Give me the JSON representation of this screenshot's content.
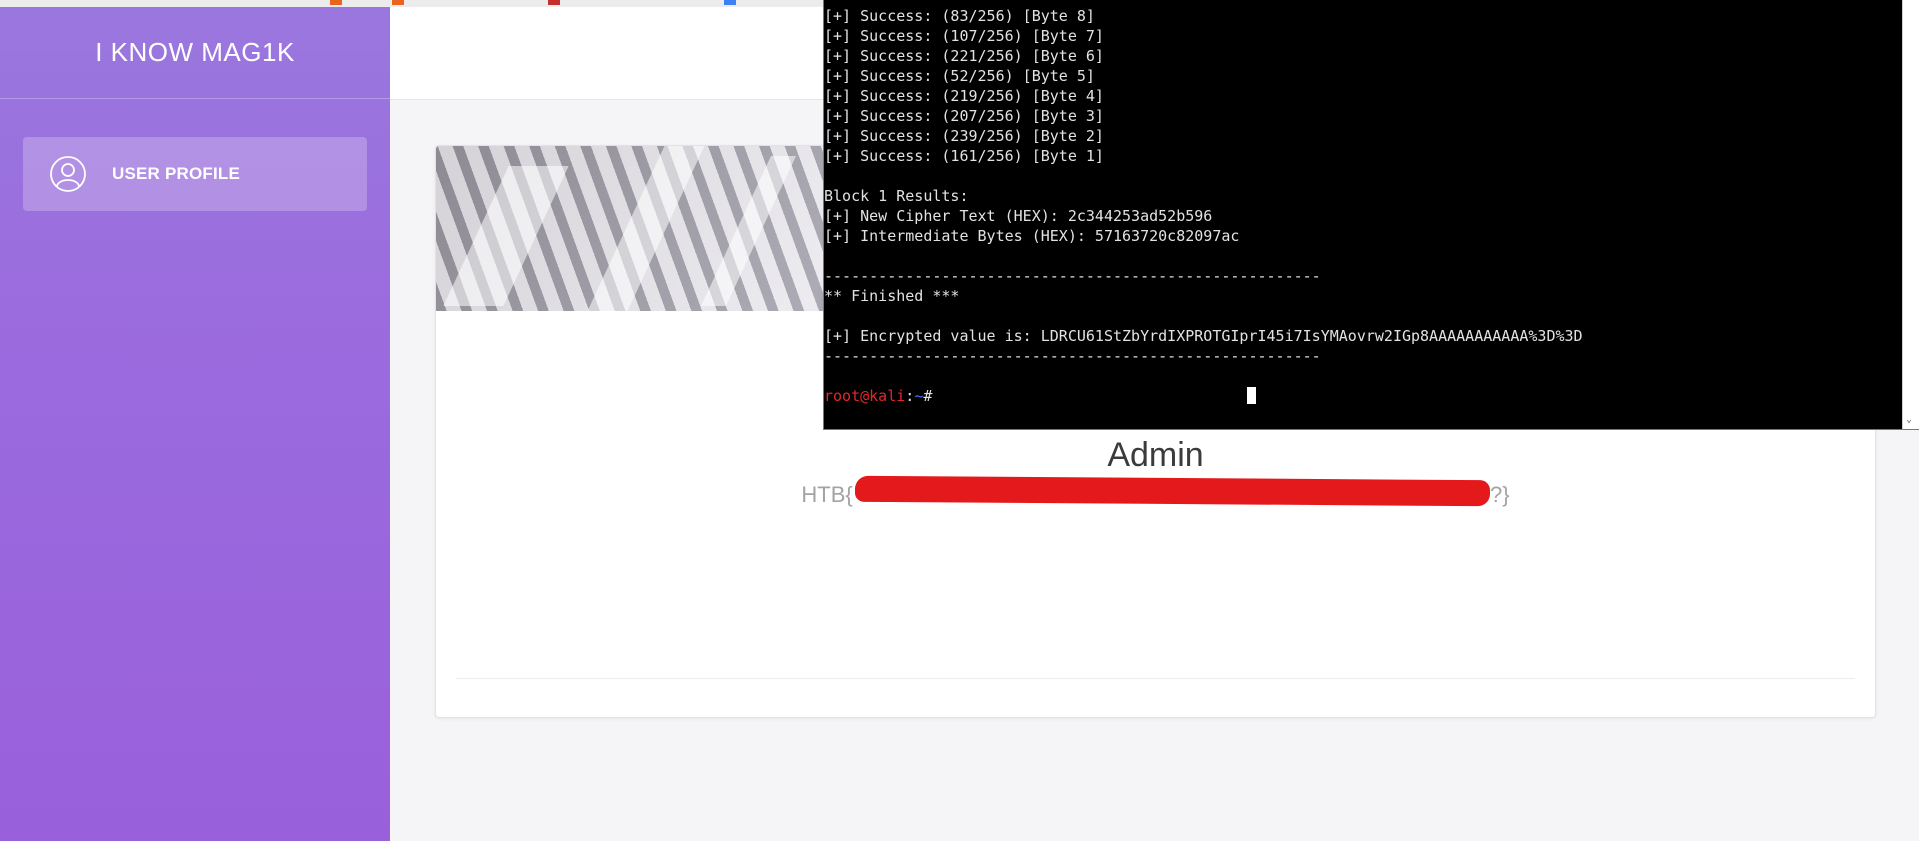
{
  "app": {
    "brand": "I KNOW MAG1K"
  },
  "sidebar": {
    "items": [
      {
        "label": "USER PROFILE",
        "icon": "user-icon"
      }
    ]
  },
  "profile": {
    "name": "Admin",
    "flag_visible": "HTB{",
    "flag_tail": "??}"
  },
  "terminal": {
    "lines": [
      "[+] Success: (83/256) [Byte 8]",
      "[+] Success: (107/256) [Byte 7]",
      "[+] Success: (221/256) [Byte 6]",
      "[+] Success: (52/256) [Byte 5]",
      "[+] Success: (219/256) [Byte 4]",
      "[+] Success: (207/256) [Byte 3]",
      "[+] Success: (239/256) [Byte 2]",
      "[+] Success: (161/256) [Byte 1]",
      "",
      "Block 1 Results:",
      "[+] New Cipher Text (HEX): 2c344253ad52b596",
      "[+] Intermediate Bytes (HEX): 57163720c82097ac",
      "",
      "-------------------------------------------------------",
      "** Finished ***",
      "",
      "[+] Encrypted value is: LDRCU61StZbYrdIXPROTGIprI45i7IsYMAovrw2IGp8AAAAAAAAAAA%3D%3D",
      "-------------------------------------------------------",
      ""
    ],
    "prompt_user": "root@kali",
    "prompt_sep": ":",
    "prompt_path": "~",
    "prompt_symbol": "#"
  },
  "colors": {
    "sidebar": "#9b6bde",
    "terminal_bg": "#000000",
    "redaction": "#e3191b",
    "prompt_user": "#e0282c"
  }
}
